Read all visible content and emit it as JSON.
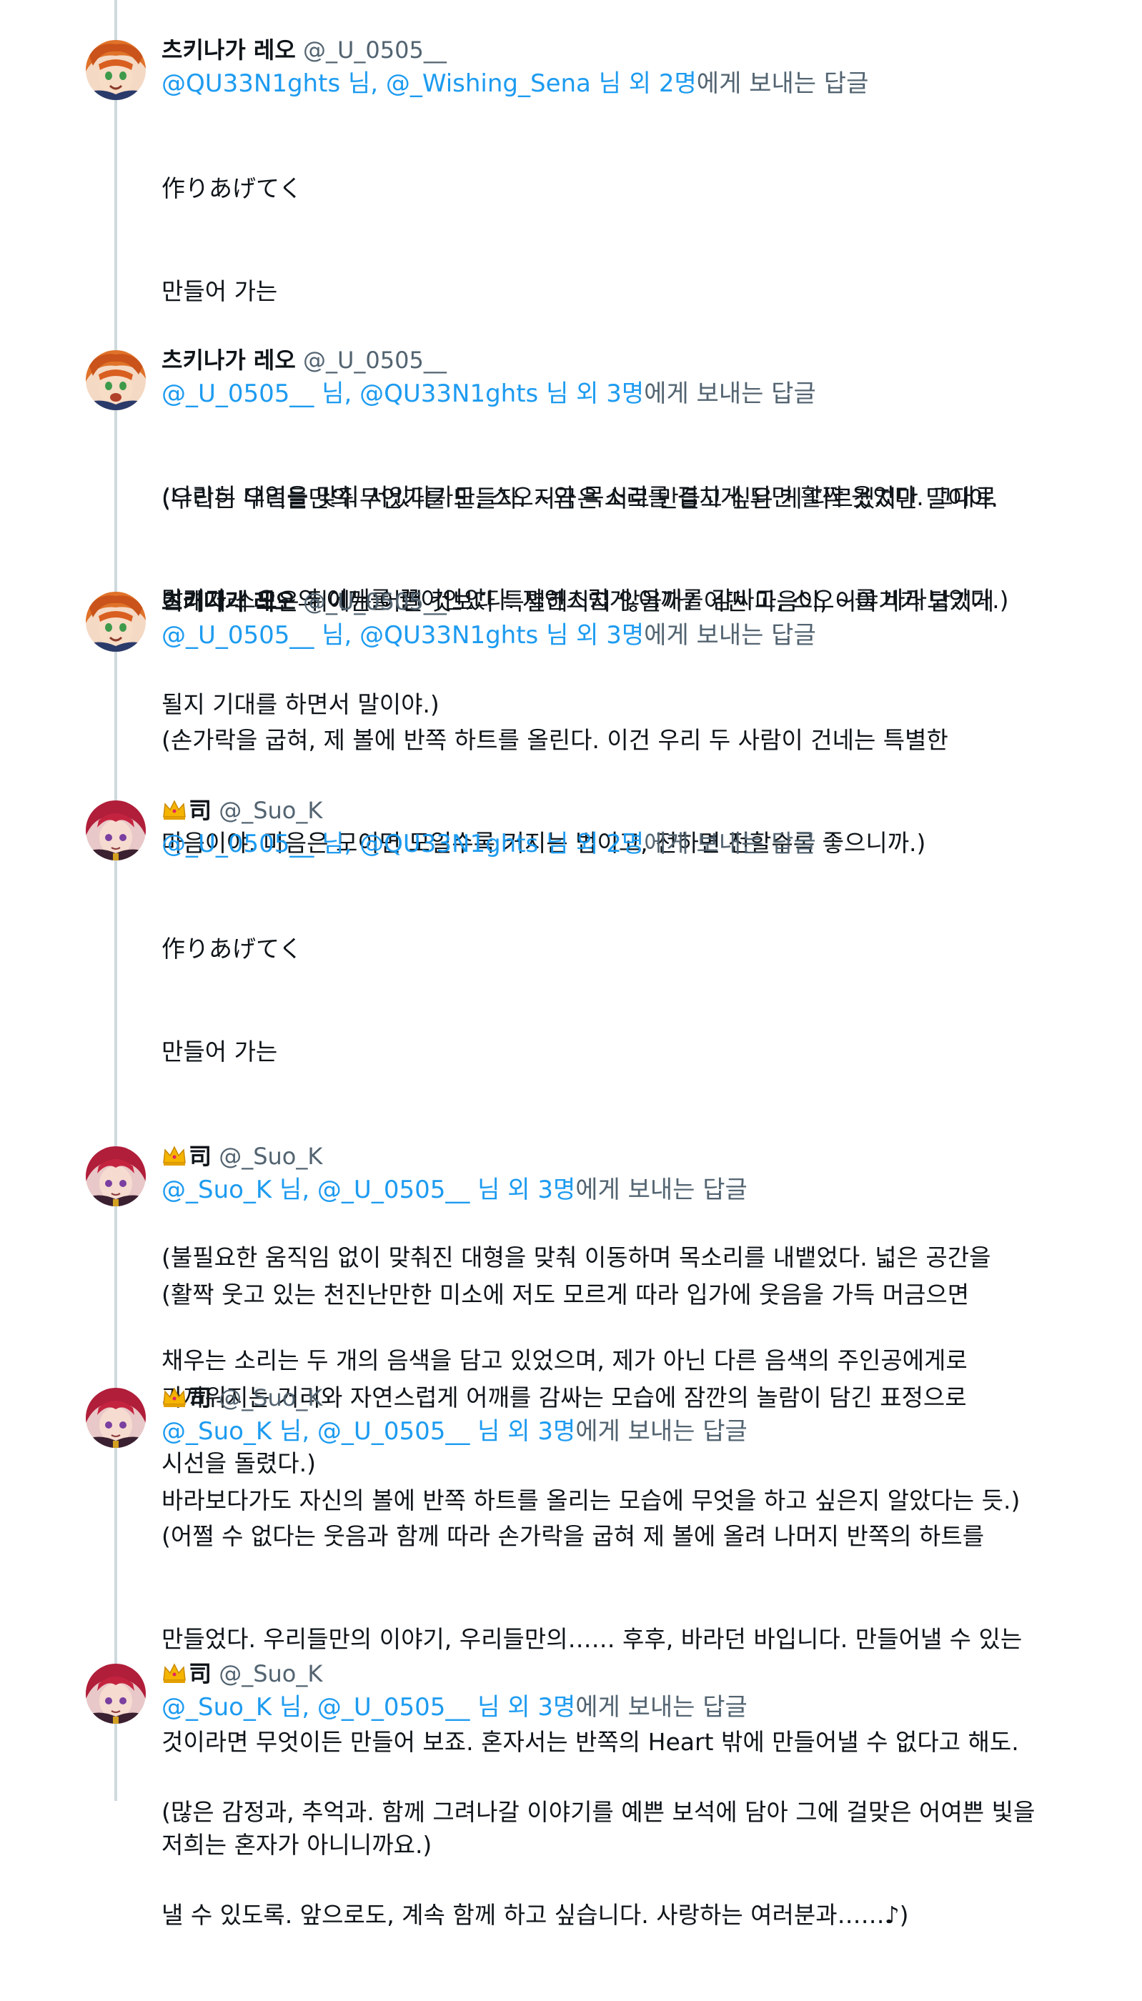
{
  "tweets": [
    {
      "avatar": "leo",
      "name": "츠키나가 레오",
      "crown": false,
      "handle": "@_U_0505__",
      "reply_to": [
        "@QU33N1ghts 님, @_Wishing_Sena 님 외 2명",
        "에게 보내는 답글"
      ],
      "lines": [
        "作りあげてく",
        "만들어 가는",
        "",
        "(나란히 대열을 맞춰 서있다가도, 스오~와 목소리를 겹치게 되면 활짝 웃었다. 그대로",
        "달려가 스오~의 어깨를 끌어안았다. 자연스럽게 어깨를 감싸고, 스오~를 바라보았다.)"
      ]
    },
    {
      "avatar": "leo2",
      "name": "츠키나가 레오",
      "crown": false,
      "handle": "@_U_0505__",
      "reply_to": [
        "@_U_0505__ 님, @QU33N1ghts 님 외 3명",
        "에게 보내는 답글"
      ],
      "lines": [
        "(우리는 우리들만의 무언가를 만들자. 지금은 서로 만들고 싶은 게 다르겠지만 말이야.",
        "이래저래 모은 뒤에는 어떤 것보다 특별해지지 않을까? 어떤 마음이, 이야기가 담기게",
        "될지 기대를 하면서 말이야.)"
      ]
    },
    {
      "avatar": "leo",
      "name": "츠키나가 레오",
      "crown": false,
      "handle": "@_U_0505__",
      "reply_to": [
        "@_U_0505__ 님, @QU33N1ghts 님 외 3명",
        "에게 보내는 답글"
      ],
      "lines": [
        "(손가락을 굽혀, 제 볼에 반쪽 하트를 올린다. 이건 우리 두 사람이 건네는 특별한",
        "마음이야. 마음은 모이면 모일수록 커지는 법이고, 전하면 전할수록 좋으니까.)"
      ]
    },
    {
      "avatar": "suo",
      "name": "司",
      "crown": true,
      "handle": "@_Suo_K",
      "reply_to": [
        "@_U_0505__ 님, @QU33N1ghts 님 외 2명",
        "에게 보내는 답글"
      ],
      "lines": [
        "作りあげてく",
        "만들어 가는",
        "",
        "(불필요한 움직임 없이 맞춰진 대형을 맞춰 이동하며 목소리를 내뱉었다. 넓은 공간을",
        "채우는 소리는 두 개의 음색을 담고 있었으며, 제가 아닌 다른 음색의 주인공에게로",
        "시선을 돌렸다.)"
      ]
    },
    {
      "avatar": "suo",
      "name": "司",
      "crown": true,
      "handle": "@_Suo_K",
      "reply_to": [
        "@_Suo_K 님, @_U_0505__ 님 외 3명",
        "에게 보내는 답글"
      ],
      "lines": [
        "(활짝 웃고 있는 천진난만한 미소에 저도 모르게 따라 입가에 웃음을 가득 머금으면",
        "가까워지는 거리와 자연스럽게 어깨를 감싸는 모습에 잠깐의 놀람이 담긴 표정으로",
        "바라보다가도 자신의 볼에 반쪽 하트를 올리는 모습에 무엇을 하고 싶은지 알았다는 듯.)"
      ]
    },
    {
      "avatar": "suo",
      "name": "司",
      "crown": true,
      "handle": "@_Suo_K",
      "reply_to": [
        "@_Suo_K 님, @_U_0505__ 님 외 3명",
        "에게 보내는 답글"
      ],
      "lines": [
        "(어쩔 수 없다는 웃음과 함께 따라 손가락을 굽혀 제 볼에 올려 나머지 반쪽의 하트를",
        "만들었다. 우리들만의 이야기, 우리들만의…… 후후, 바라던 바입니다. 만들어낼 수 있는",
        "것이라면 무엇이든 만들어 보죠. 혼자서는 반쪽의 Heart 밖에 만들어낼 수 없다고 해도.",
        "저희는 혼자가 아니니까요.)"
      ]
    },
    {
      "avatar": "suo",
      "name": "司",
      "crown": true,
      "handle": "@_Suo_K",
      "reply_to": [
        "@_Suo_K 님, @_U_0505__ 님 외 3명",
        "에게 보내는 답글"
      ],
      "lines": [
        "(많은 감정과, 추억과. 함께 그려나갈 이야기를 예쁜 보석에 담아 그에 걸맞은 어여쁜 빛을",
        "낼 수 있도록. 앞으로도, 계속 함께 하고 싶습니다. 사랑하는 여러분과……♪)"
      ]
    }
  ]
}
